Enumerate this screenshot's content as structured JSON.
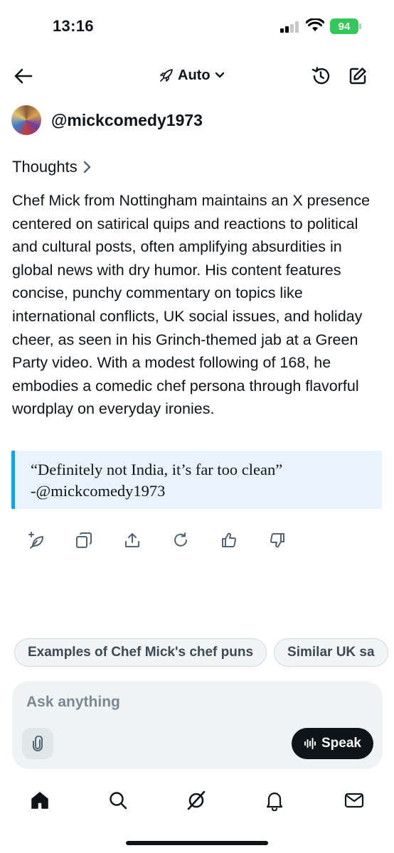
{
  "status_bar": {
    "time": "13:16",
    "battery": "94"
  },
  "nav": {
    "model_label": "Auto"
  },
  "profile": {
    "handle": "@mickcomedy1973"
  },
  "thoughts": {
    "label": "Thoughts"
  },
  "response": {
    "paragraph": "Chef Mick from Nottingham maintains an X presence centered on satirical quips and reactions to political and cultural posts, often amplifying absurdities in global news with dry humor. His content features concise, punchy commentary on topics like international conflicts, UK social issues, and holiday cheer, as seen in his Grinch-themed jab at a Green Party video. With a modest following of 168, he embodies a comedic chef persona through flavorful wordplay on everyday ironies.",
    "quote_line1": "“Definitely not India, it’s far too clean”",
    "quote_line2": "-@mickcomedy1973"
  },
  "actions": [
    "sparkle-leaf-icon",
    "copy-icon",
    "share-icon",
    "regenerate-icon",
    "thumbs-up-icon",
    "thumbs-down-icon"
  ],
  "suggestions": [
    "Examples of Chef Mick's chef puns",
    "Similar UK sa"
  ],
  "composer": {
    "placeholder": "Ask anything",
    "speak_label": "Speak"
  },
  "bottom_nav": [
    "home-icon",
    "search-icon",
    "grok-icon",
    "notifications-icon",
    "messages-icon"
  ],
  "colors": {
    "accent": "#1d9bf0",
    "quote_bg": "#e8f3fd",
    "battery": "#34c759"
  }
}
